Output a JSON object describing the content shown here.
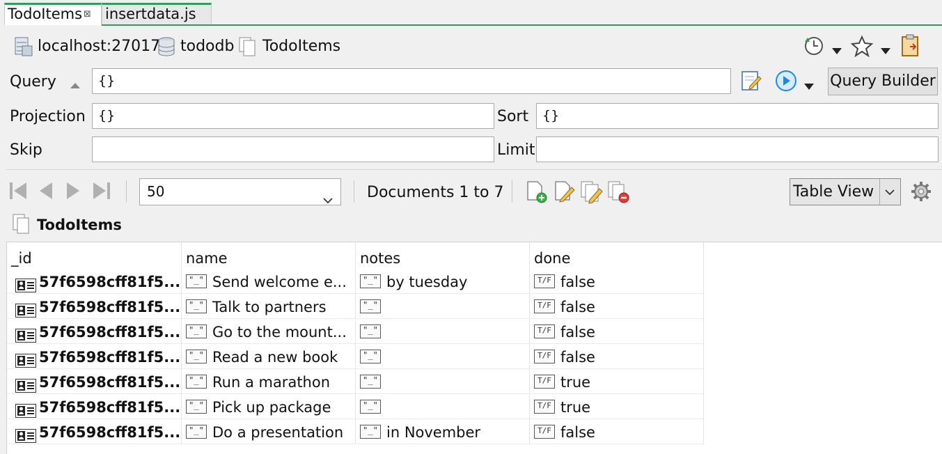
{
  "tabs": [
    {
      "label": "TodoItems",
      "close": "⊠"
    },
    {
      "label": "insertdata.js"
    }
  ],
  "breadcrumb": {
    "server": "localhost:27017",
    "database": "tododb",
    "collection": "TodoItems"
  },
  "query": {
    "query_label": "Query",
    "query_value": "{}",
    "projection_label": "Projection",
    "projection_value": "{}",
    "sort_label": "Sort",
    "sort_value": "{}",
    "skip_label": "Skip",
    "skip_value": "",
    "limit_label": "Limit",
    "limit_value": "",
    "query_builder_label": "Query Builder"
  },
  "results_toolbar": {
    "page_size": "50",
    "documents_text": "Documents 1 to 7",
    "view_mode": "Table View"
  },
  "collection_title": "TodoItems",
  "table": {
    "columns": [
      "_id",
      "name",
      "notes",
      "done"
    ],
    "rows": [
      {
        "id": "57f6598cff81f5...",
        "name": "Send welcome e...",
        "notes": "by tuesday",
        "done": "false"
      },
      {
        "id": "57f6598cff81f5...",
        "name": "Talk to partners",
        "notes": "",
        "done": "false"
      },
      {
        "id": "57f6598cff81f5...",
        "name": "Go to the mount...",
        "notes": "",
        "done": "false"
      },
      {
        "id": "57f6598cff81f5...",
        "name": "Read a new book",
        "notes": "",
        "done": "false"
      },
      {
        "id": "57f6598cff81f5...",
        "name": "Run a marathon",
        "notes": "",
        "done": "true"
      },
      {
        "id": "57f6598cff81f5...",
        "name": "Pick up package",
        "notes": "",
        "done": "true"
      },
      {
        "id": "57f6598cff81f5...",
        "name": "Do a presentation",
        "notes": "in November",
        "done": "false"
      }
    ]
  },
  "type_icons": {
    "string": "\"_\"",
    "boolean": "T/F"
  },
  "colors": {
    "tab_accent": "#2e9d5d",
    "run_icon": "#1e88e5"
  }
}
